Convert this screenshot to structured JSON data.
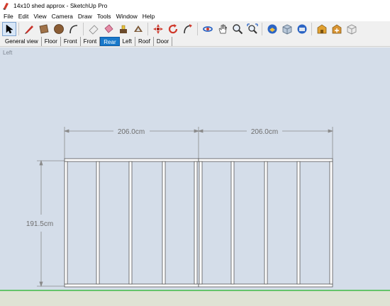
{
  "window": {
    "title": "14x10 shed approx - SketchUp Pro"
  },
  "menu": [
    "File",
    "Edit",
    "View",
    "Camera",
    "Draw",
    "Tools",
    "Window",
    "Help"
  ],
  "toolbar": {
    "tools": [
      "select-icon",
      "pencil-line-icon",
      "rectangle-icon",
      "circle-icon",
      "arc-icon",
      "eraser-icon",
      "paint-bucket-icon",
      "push-pull-icon",
      "offset-icon",
      "move-icon",
      "rotate-icon",
      "follow-me-icon",
      "orbit-icon",
      "pan-icon",
      "zoom-icon",
      "zoom-extents-icon",
      "iso-view-icon",
      "front-view-icon",
      "side-view-icon",
      "warehouse-icon",
      "extension-icon",
      "component-icon"
    ]
  },
  "scenes": {
    "tabs": [
      "General view",
      "Floor",
      "Front",
      "Front",
      "Rear",
      "Left",
      "Roof",
      "Door"
    ],
    "active": "Rear"
  },
  "viewport": {
    "view_name": "Left",
    "dimensions": {
      "width_left": "206.0cm",
      "width_right": "206.0cm",
      "height": "191.5cm"
    }
  },
  "colors": {
    "viewport_bg": "#d4dde9",
    "ground_line": "#64c46a",
    "active_scene": "#1979ca"
  }
}
